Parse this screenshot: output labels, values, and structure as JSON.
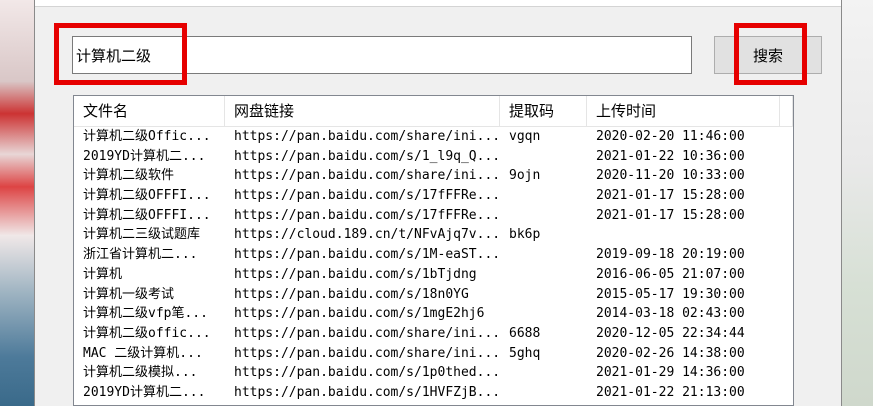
{
  "search": {
    "value": "计算机二级",
    "button_label": "搜索"
  },
  "table": {
    "headers": [
      "文件名",
      "网盘链接",
      "提取码",
      "上传时间"
    ],
    "rows": [
      [
        "计算机二级Offic...",
        "https://pan.baidu.com/share/ini...",
        "vgqn",
        "2020-02-20 11:46:00"
      ],
      [
        "2019YD计算机二...",
        "https://pan.baidu.com/s/1_l9q_Q...",
        "",
        "2021-01-22 10:36:00"
      ],
      [
        "计算机二级软件",
        "https://pan.baidu.com/share/ini...",
        "9ojn",
        "2020-11-20 10:33:00"
      ],
      [
        "计算机二级OFFFI...",
        "https://pan.baidu.com/s/17fFFRe...",
        "",
        "2021-01-17 15:28:00"
      ],
      [
        "计算机二级OFFFI...",
        "https://pan.baidu.com/s/17fFFRe...",
        "",
        "2021-01-17 15:28:00"
      ],
      [
        "计算机二三级试题库",
        "https://cloud.189.cn/t/NFvAjq7v...",
        "bk6p",
        ""
      ],
      [
        "浙江省计算机二...",
        "https://pan.baidu.com/s/1M-eaST...",
        "",
        "2019-09-18 20:19:00"
      ],
      [
        "计算机",
        "https://pan.baidu.com/s/1bTjdng",
        "",
        "2016-06-05 21:07:00"
      ],
      [
        "计算机一级考试",
        "https://pan.baidu.com/s/18n0YG",
        "",
        "2015-05-17 19:30:00"
      ],
      [
        "计算机二级vfp笔...",
        "https://pan.baidu.com/s/1mgE2hj6",
        "",
        "2014-03-18 02:43:00"
      ],
      [
        "计算机二级offic...",
        "https://pan.baidu.com/share/ini...",
        "6688",
        "2020-12-05 22:34:44"
      ],
      [
        "MAC 二级计算机...",
        "https://pan.baidu.com/share/ini...",
        "5ghq",
        "2020-02-26 14:38:00"
      ],
      [
        "计算机二级模拟...",
        "https://pan.baidu.com/s/1p0thed...",
        "",
        "2021-01-29 14:36:00"
      ],
      [
        "2019YD计算机二...",
        "https://pan.baidu.com/s/1HVFZjB...",
        "",
        "2021-01-22 21:13:00"
      ]
    ]
  },
  "colors": {
    "highlight": "#e60000"
  }
}
